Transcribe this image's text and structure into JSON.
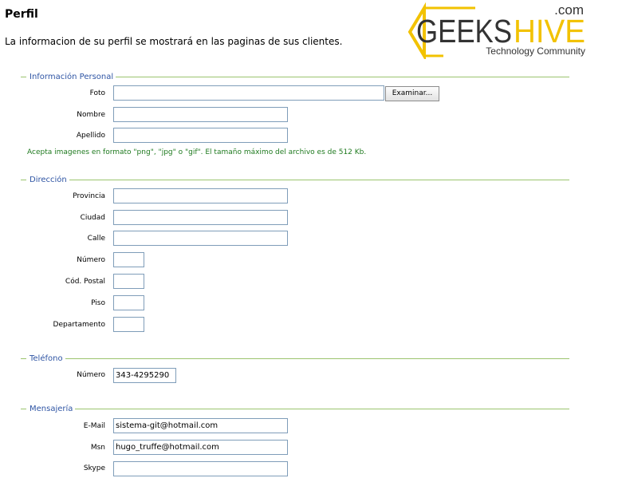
{
  "page": {
    "title": "Perfil",
    "intro": "La informacion de su perfil se mostrará en las paginas de sus clientes."
  },
  "logo": {
    "tld": ".com",
    "brand_left": "GEEKS",
    "brand_right": "HIVE",
    "tagline": "Technology Community",
    "colors": {
      "accent": "#f2c200",
      "dark": "#333333"
    }
  },
  "sections": {
    "personal": {
      "legend": "Información Personal",
      "foto_label": "Foto",
      "browse_button": "Examinar...",
      "nombre_label": "Nombre",
      "apellido_label": "Apellido",
      "note": "Acepta imagenes en formato \"png\", \"jpg\" o \"gif\". El tamaño máximo del archivo es de 512 Kb."
    },
    "direccion": {
      "legend": "Dirección",
      "provincia_label": "Provincia",
      "ciudad_label": "Ciudad",
      "calle_label": "Calle",
      "numero_label": "Número",
      "cp_label": "Cód. Postal",
      "piso_label": "Piso",
      "depto_label": "Departamento"
    },
    "telefono": {
      "legend": "Teléfono",
      "numero_label": "Número",
      "numero_value": "343-4295290"
    },
    "mensajeria": {
      "legend": "Mensajería",
      "email_label": "E-Mail",
      "email_value": "sistema-git@hotmail.com",
      "msn_label": "Msn",
      "msn_value": "hugo_truffe@hotmail.com",
      "skype_label": "Skype"
    }
  },
  "colors": {
    "legend_text": "#2f55a4",
    "rule": "#9bc46e",
    "note_text": "#1f7a1f"
  }
}
